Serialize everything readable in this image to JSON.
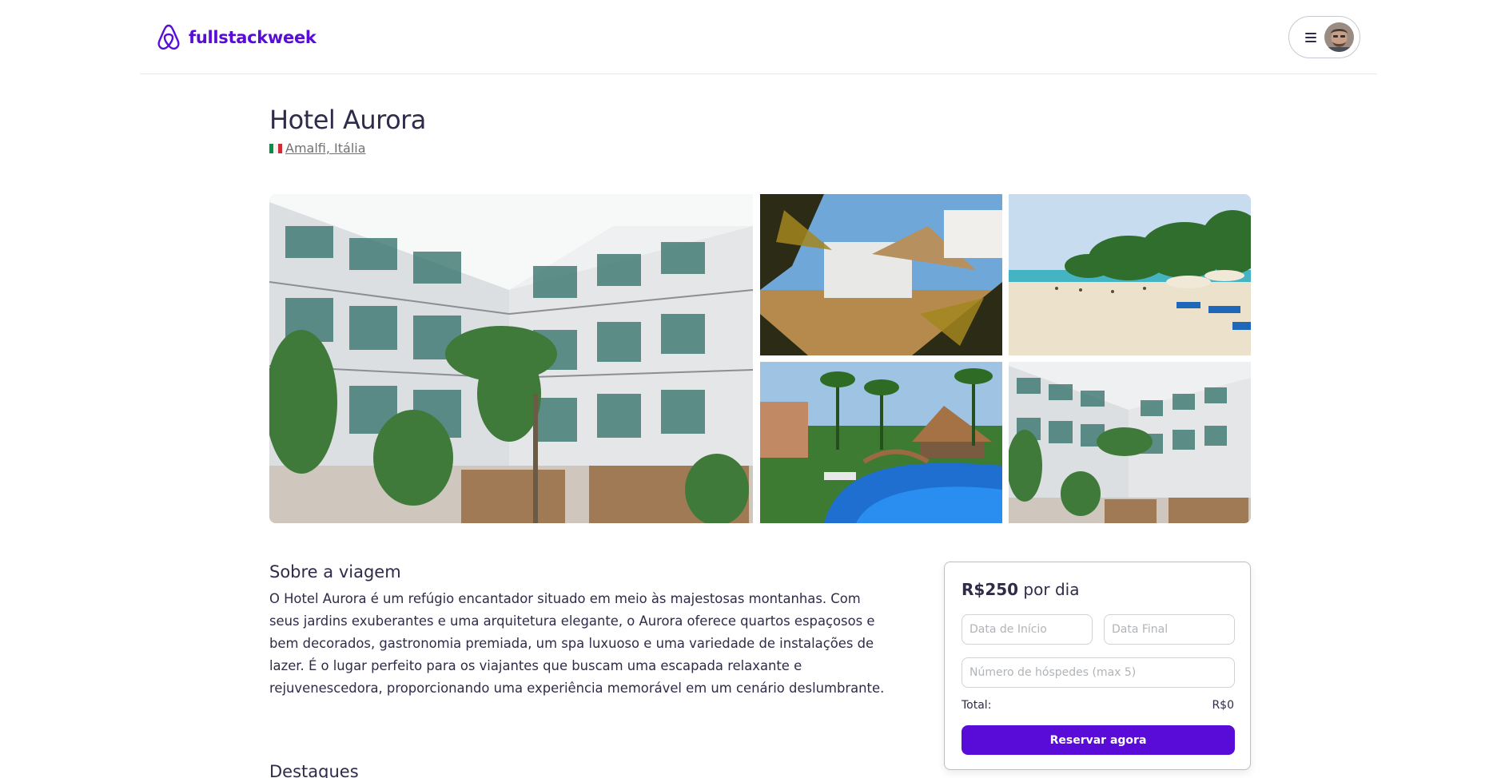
{
  "brand": {
    "name": "fullstackweek",
    "color": "#590bd8",
    "logo_icon": "airbnb-logo-icon"
  },
  "header": {
    "menu_icon": "hamburger-menu-icon",
    "avatar_icon": "user-avatar"
  },
  "hotel": {
    "name": "Hotel Aurora",
    "location": "Amalfi, Itália",
    "flag_icon": "italy-flag-icon",
    "photos": [
      "hotel-building-photo",
      "resort-palms-photo",
      "beach-photo",
      "pool-photo",
      "hotel-courtyard-photo"
    ]
  },
  "about": {
    "heading": "Sobre a viagem",
    "text": "O Hotel Aurora é um refúgio encantador situado em meio às majestosas montanhas. Com seus jardins exuberantes e uma arquitetura elegante, o Aurora oferece quartos espaçosos e bem decorados, gastronomia premiada, um spa luxuoso e uma variedade de instalações de lazer. É o lugar perfeito para os viajantes que buscam uma escapada relaxante e rejuvenescedora, proporcionando uma experiência memorável em um cenário deslumbrante."
  },
  "highlights": {
    "heading": "Destaques"
  },
  "booking": {
    "price": "R$250",
    "price_suffix": " por dia",
    "start_placeholder": "Data de Início",
    "end_placeholder": "Data Final",
    "guests_placeholder": "Número de hóspedes (max 5)",
    "total_label": "Total:",
    "total_value": "R$0",
    "reserve_label": "Reservar agora"
  }
}
